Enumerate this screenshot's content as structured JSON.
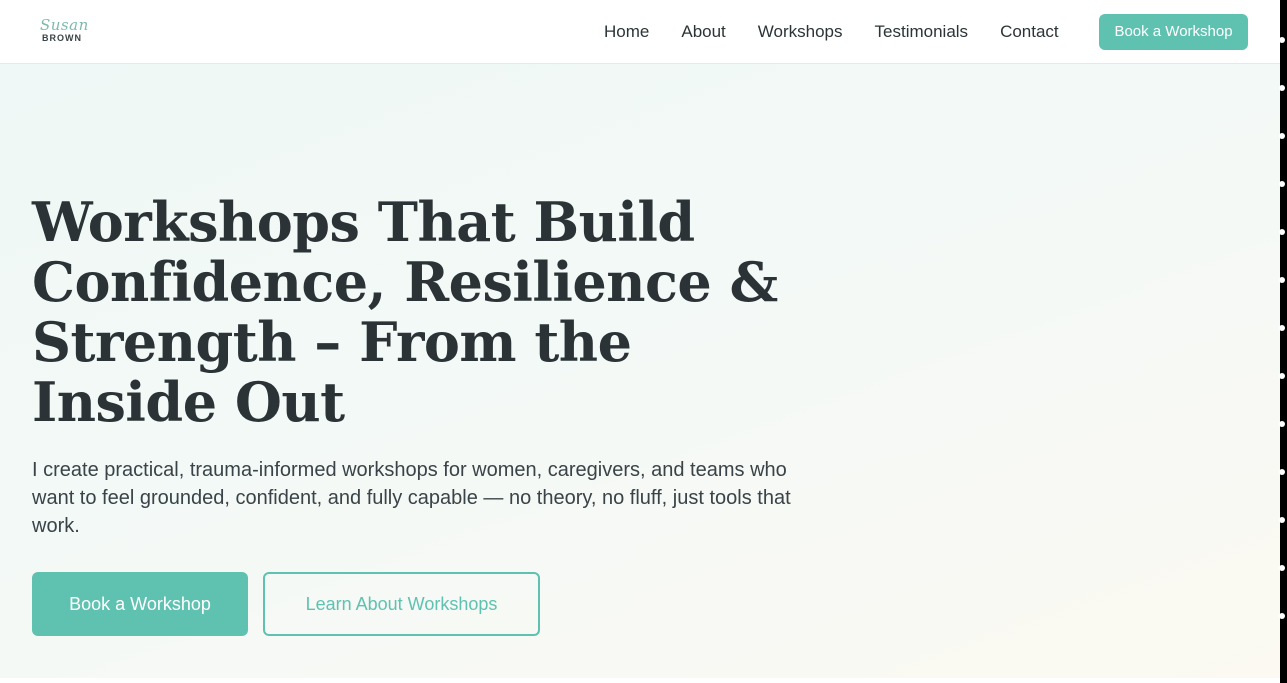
{
  "header": {
    "logo_script": "Susan",
    "logo_name": "BROWN",
    "nav": [
      {
        "label": "Home"
      },
      {
        "label": "About"
      },
      {
        "label": "Workshops"
      },
      {
        "label": "Testimonials"
      },
      {
        "label": "Contact"
      }
    ],
    "cta_label": "Book a Workshop"
  },
  "hero": {
    "title": "Workshops That Build Confidence, Resilience & Strength – From the Inside Out",
    "subtitle": "I create practical, trauma-informed workshops for women, caregivers, and teams who want to feel grounded, confident, and fully capable — no theory, no fluff, just tools that work.",
    "primary_button": "Book a Workshop",
    "secondary_button": "Learn About Workshops"
  },
  "colors": {
    "accent": "#5fc2b0",
    "text": "#2c3437",
    "hero_bg_start": "#eff8f6",
    "hero_bg_end": "#fbf9f1"
  }
}
